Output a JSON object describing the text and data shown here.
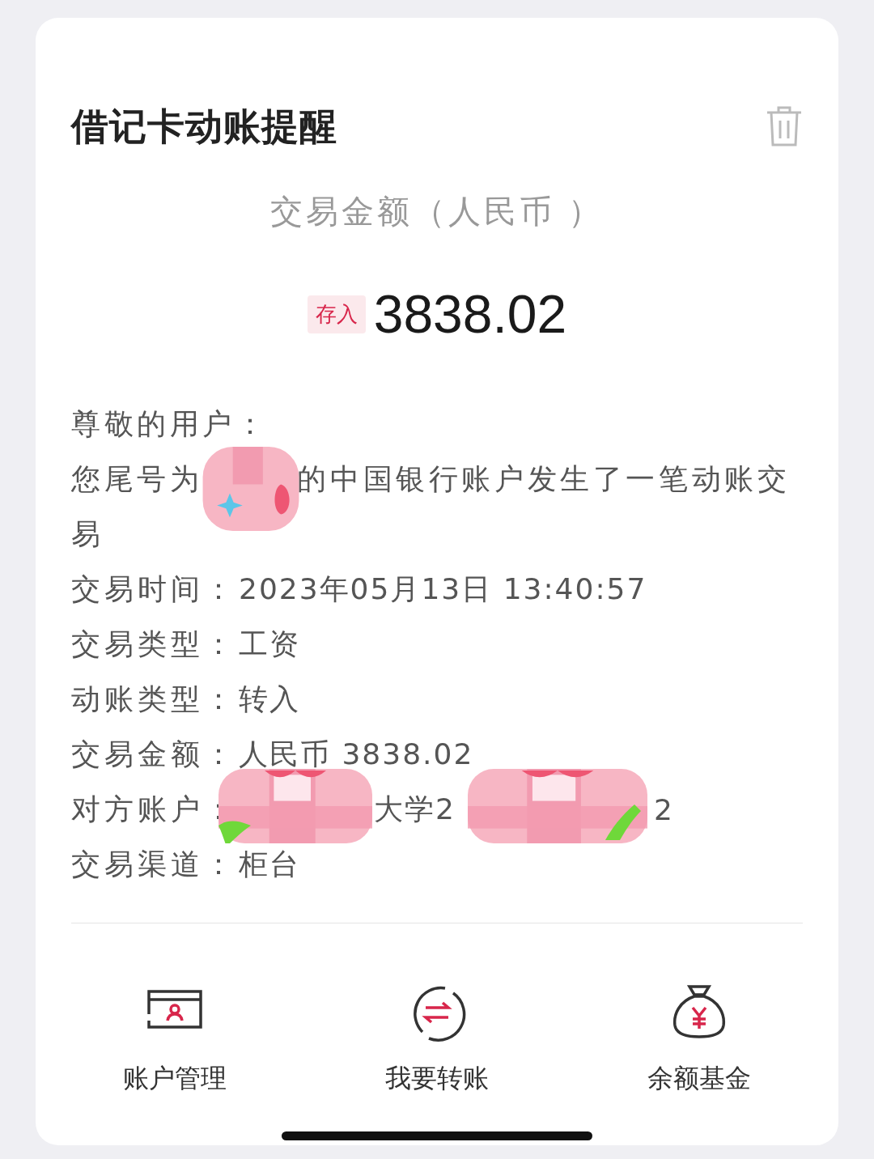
{
  "title": "借记卡动账提醒",
  "amount_caption": "交易金额（人民币 ）",
  "deposit_badge": "存入",
  "amount": "3838.02",
  "greeting": "尊敬的用户：",
  "notice": {
    "before": "您尾号为",
    "after": "的中国银行账户发生了一笔动账交",
    "continued": "易"
  },
  "details": [
    {
      "label": "交易时间：",
      "values": [
        "2023年05月13日 13:40:57"
      ]
    },
    {
      "label": "交易类型：",
      "values": [
        "工资"
      ]
    },
    {
      "label": "动账类型：",
      "values": [
        "转入"
      ]
    },
    {
      "label": "交易金额：",
      "values": [
        "人民币 3838.02"
      ]
    },
    {
      "label": "对方账户：",
      "values": [
        "大学2",
        "2"
      ]
    },
    {
      "label": "交易渠道：",
      "values": [
        "柜台"
      ]
    }
  ],
  "actions": [
    {
      "kind": "account",
      "label": "账户管理"
    },
    {
      "kind": "transfer",
      "label": "我要转账"
    },
    {
      "kind": "fund",
      "label": "余额基金"
    }
  ]
}
